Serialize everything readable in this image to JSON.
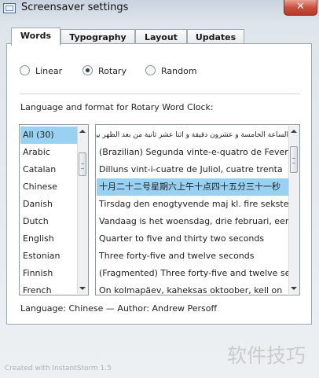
{
  "window": {
    "title": "Screensaver settings",
    "close_glyph": "✕",
    "icon": "app-window-icon"
  },
  "tabs": [
    {
      "label": "Words",
      "active": true
    },
    {
      "label": "Typography",
      "active": false
    },
    {
      "label": "Layout",
      "active": false
    },
    {
      "label": "Updates",
      "active": false
    }
  ],
  "clock_modes": [
    {
      "label": "Linear",
      "selected": false
    },
    {
      "label": "Rotary",
      "selected": true
    },
    {
      "label": "Random",
      "selected": false
    }
  ],
  "language_section_label": "Language and format for Rotary Word Clock:",
  "languages": {
    "items": [
      "All (30)",
      "Arabic",
      "Catalan",
      "Chinese",
      "Danish",
      "Dutch",
      "English",
      "Estonian",
      "Finnish",
      "French"
    ],
    "selected_index": 0
  },
  "formats": {
    "items": [
      "الساعة الخامسة و عشرون دقيقة و اثنا عشر ثانية من بعد الظهر يوم الخميس ستة عشر من شهر يناير",
      "(Brazilian) Segunda vinte-e-quatro de Fevereiro",
      "Dilluns vint-i-cuatre de Juliol, cuatre trenta",
      "十月二十二号星期六上午十点四十五分三十一秒",
      "Tirsdag den enogtyvende maj kl. fire seksten",
      "Vandaag is het woensdag, drie februari, een",
      "Quarter to five and thirty two seconds",
      "Three forty-five and twelve seconds",
      "(Fragmented) Three forty-five and twelve seconds",
      "On kolmapäev, kaheksas oktoober, kell on"
    ],
    "selected_index": 3
  },
  "info_line": "Language: Chinese — Author: Andrew Persoff",
  "watermark": "软件技巧",
  "credit": "Created with InstantStorm 1.5",
  "colors": {
    "selection": "#99d1f2",
    "close_button": "#c8503d"
  }
}
